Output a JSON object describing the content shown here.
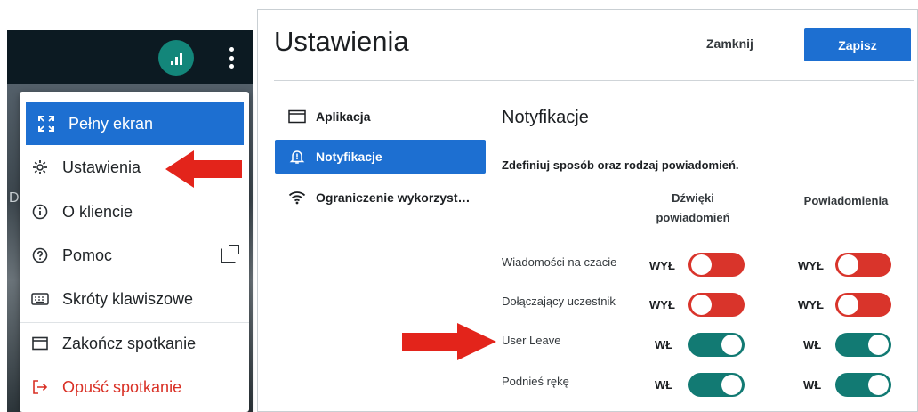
{
  "menu": {
    "items": [
      {
        "label": "Pełny ekran",
        "icon": "fullscreen-icon",
        "active": true
      },
      {
        "label": "Ustawienia",
        "icon": "gear-icon"
      },
      {
        "label": "O kliencie",
        "icon": "info-icon"
      },
      {
        "label": "Pomoc",
        "icon": "help-icon"
      },
      {
        "label": "Skróty klawiszowe",
        "icon": "keyboard-icon"
      },
      {
        "label": "Zakończ spotkanie",
        "icon": "window-icon"
      },
      {
        "label": "Opuść spotkanie",
        "icon": "exit-icon"
      }
    ],
    "accent": "#1d6fd1",
    "danger": "#d93025",
    "background_letter": "D"
  },
  "settings": {
    "title": "Ustawienia",
    "close_label": "Zamknij",
    "save_label": "Zapisz",
    "nav": [
      {
        "label": "Aplikacja",
        "icon": "window-icon"
      },
      {
        "label": "Notyfikacje",
        "icon": "bell-icon",
        "selected": true
      },
      {
        "label": "Ograniczenie wykorzyst…",
        "icon": "wifi-icon"
      }
    ],
    "content": {
      "title": "Notyfikacje",
      "subtitle": "Zdefiniuj sposób oraz rodzaj powiadomień.",
      "col_sounds_line1": "Dźwięki",
      "col_sounds_line2": "powiadomień",
      "col_notifications": "Powiadomienia",
      "rows": [
        {
          "label": "Wiadomości na czacie",
          "sound_state": "WYŁ",
          "sound_on": false,
          "notif_state": "WYŁ",
          "notif_on": false
        },
        {
          "label": "Dołączający uczestnik",
          "sound_state": "WYŁ",
          "sound_on": false,
          "notif_state": "WYŁ",
          "notif_on": false
        },
        {
          "label": "User Leave",
          "sound_state": "WŁ",
          "sound_on": true,
          "notif_state": "WŁ",
          "notif_on": true
        },
        {
          "label": "Podnieś rękę",
          "sound_state": "WŁ",
          "sound_on": true,
          "notif_state": "WŁ",
          "notif_on": true
        }
      ]
    },
    "colors": {
      "toggle_off": "#d9342b",
      "toggle_on": "#127a73",
      "primary": "#1d6fd1"
    }
  }
}
